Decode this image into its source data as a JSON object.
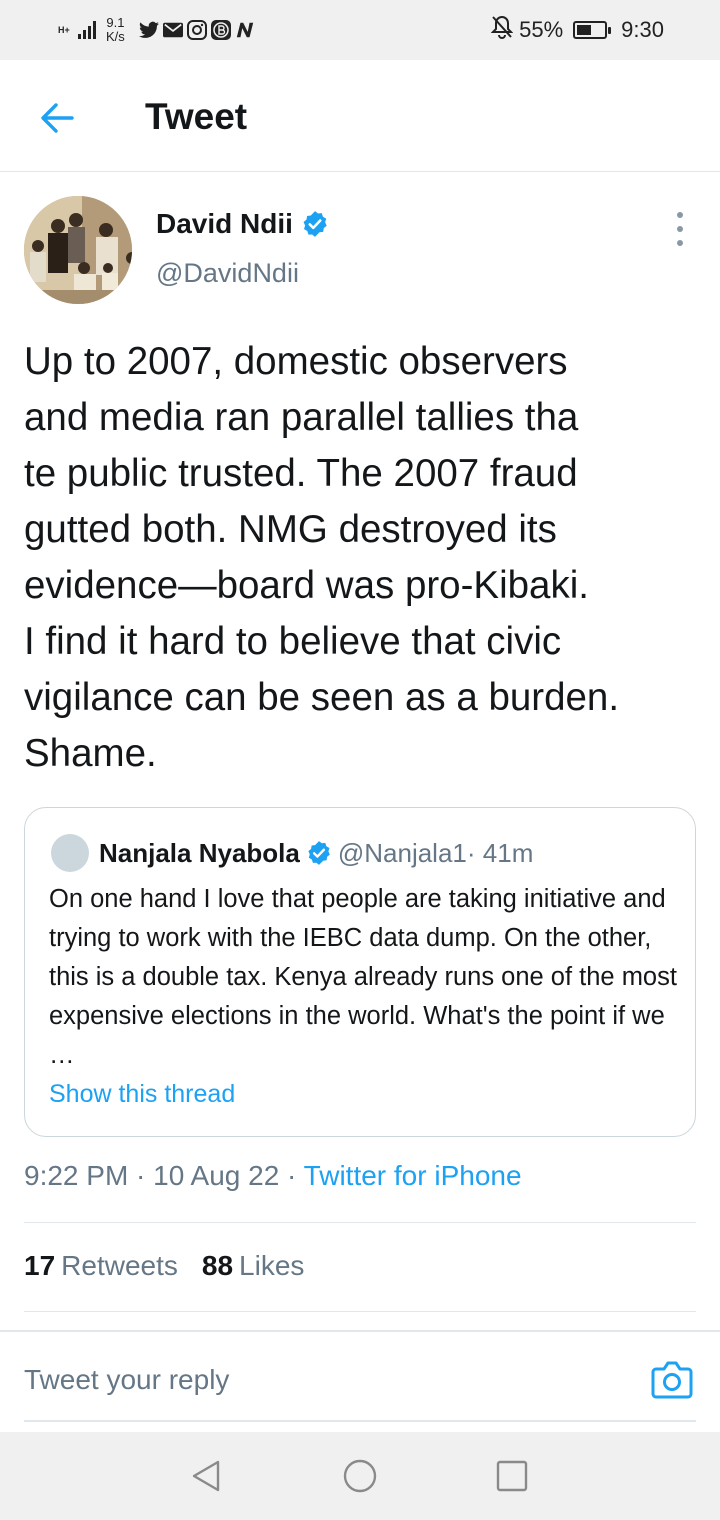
{
  "status_bar": {
    "signal_label": "H+",
    "network_speed_value": "9.1",
    "network_speed_unit": "K/s",
    "notification_icons": [
      "twitter-icon",
      "mail-icon",
      "instagram-icon",
      "b-app-icon",
      "n-app-icon"
    ],
    "battery_percent": "55%",
    "battery_level": 0.55,
    "time": "9:30"
  },
  "header": {
    "title": "Tweet"
  },
  "tweet": {
    "author_name": "David Ndii",
    "author_handle": "@DavidNdii",
    "text": "Up to 2007, domestic observers\nand media ran parallel tallies tha\nte public trusted. The 2007 fraud\ngutted both. NMG destroyed its\nevidence—board was pro-Kibaki.\nI find it hard to believe that civic\nvigilance can be seen as a burden.\nShame.",
    "timestamp": "9:22 PM · 10 Aug 22",
    "separator": " · ",
    "source": "Twitter for iPhone",
    "retweets_count": "17",
    "retweets_label": "Retweets",
    "likes_count": "88",
    "likes_label": "Likes"
  },
  "quoted_tweet": {
    "author_name": "Nanjala Nyabola",
    "author_handle": "@Nanjala1",
    "time_ago": " · 41m",
    "text": "On one hand I love that people are taking initiative and trying to work with the IEBC data dump. On the other, this is a double tax. Kenya already runs one of the most expensive elections in the world. What's the point if we …",
    "show_thread_label": "Show this thread"
  },
  "reply": {
    "placeholder": "Tweet your reply"
  },
  "colors": {
    "accent": "#1da1f2",
    "secondary_text": "#657786",
    "primary_text": "#14171a",
    "divider": "#e1e8ed"
  }
}
